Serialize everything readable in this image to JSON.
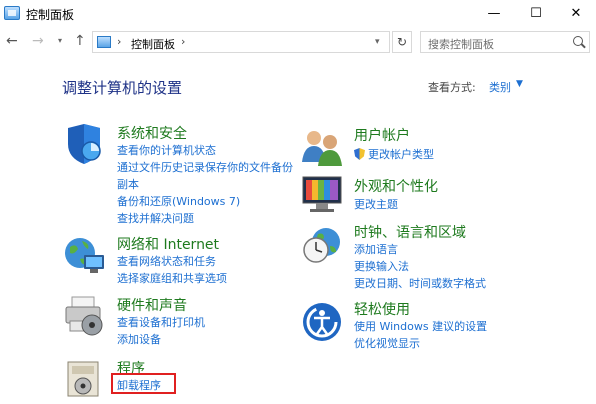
{
  "window": {
    "title": "控制面板",
    "minimize_glyph": "—",
    "maximize_glyph": "☐",
    "close_glyph": "✕"
  },
  "nav": {
    "back_glyph": "←",
    "forward_glyph": "→",
    "recent_glyph": "▾",
    "up_glyph": "↑",
    "breadcrumb_separator": "›",
    "breadcrumb": "控制面板",
    "refresh_glyph": "↻",
    "dropdown_glyph": "▾"
  },
  "search": {
    "placeholder": "搜索控制面板"
  },
  "main": {
    "title": "调整计算机的设置",
    "view_label": "查看方式:",
    "view_value": "类别",
    "view_caret": "▼"
  },
  "categories": {
    "system_security": {
      "title": "系统和安全",
      "links": [
        "查看你的计算机状态",
        "通过文件历史记录保存你的文件备份",
        "副本",
        "备份和还原(Windows 7)",
        "查找并解决问题"
      ]
    },
    "network": {
      "title": "网络和 Internet",
      "links": [
        "查看网络状态和任务",
        "选择家庭组和共享选项"
      ]
    },
    "hardware": {
      "title": "硬件和声音",
      "links": [
        "查看设备和打印机",
        "添加设备"
      ]
    },
    "programs": {
      "title": "程序",
      "links": [
        "卸载程序"
      ]
    },
    "user_accounts": {
      "title": "用户帐户",
      "links": [
        "更改帐户类型"
      ]
    },
    "appearance": {
      "title": "外观和个性化",
      "links": [
        "更改主题"
      ]
    },
    "clock_region": {
      "title": "时钟、语言和区域",
      "links": [
        "添加语言",
        "更换输入法",
        "更改日期、时间或数字格式"
      ]
    },
    "ease_of_access": {
      "title": "轻松使用",
      "links": [
        "使用 Windows 建议的设置",
        "优化视觉显示"
      ]
    }
  },
  "colors": {
    "category_title": "#1e7a1e",
    "link": "#1d6fd1",
    "page_title": "#1e3287",
    "highlight_box": "#e02020"
  }
}
